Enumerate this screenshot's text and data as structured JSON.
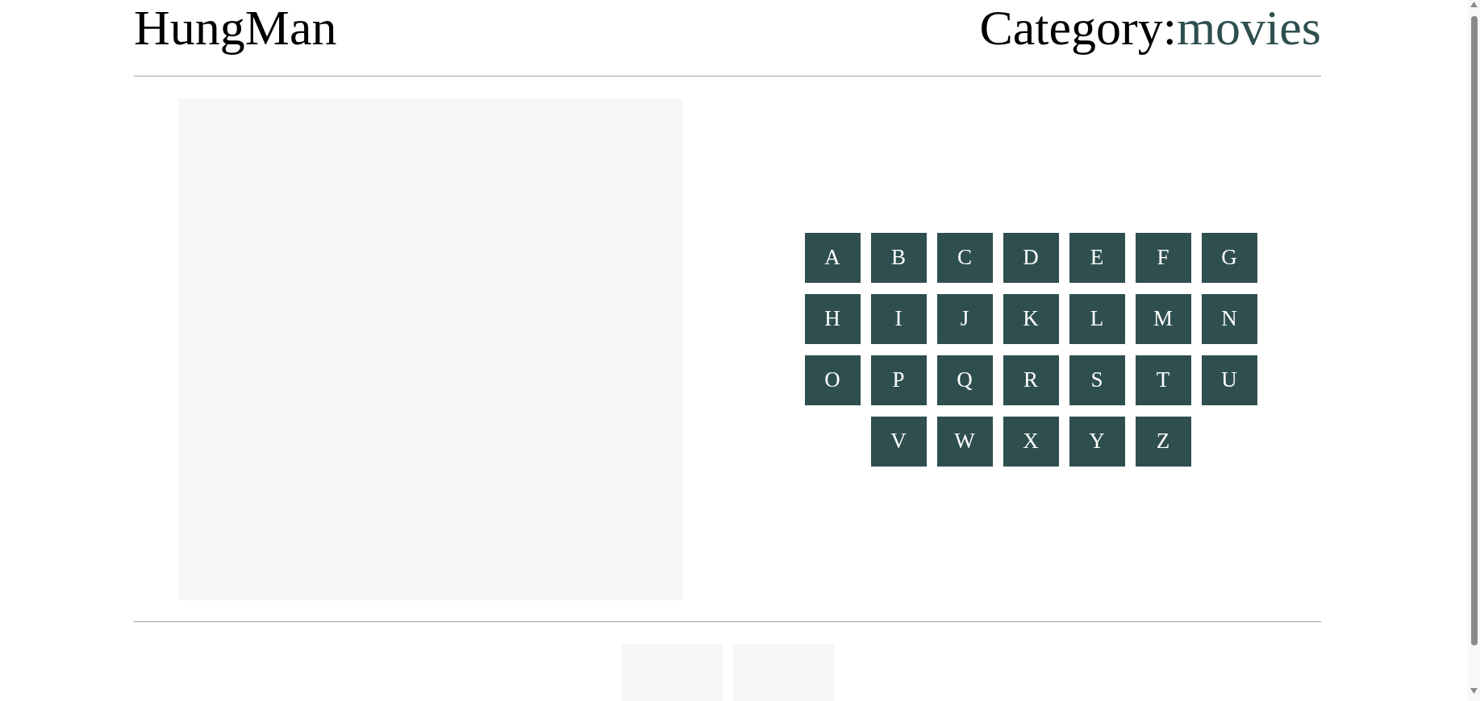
{
  "header": {
    "title": "HungMan",
    "category": {
      "label": "Category:",
      "value": "movies"
    }
  },
  "keyboard": {
    "keys": [
      "A",
      "B",
      "C",
      "D",
      "E",
      "F",
      "G",
      "H",
      "I",
      "J",
      "K",
      "L",
      "M",
      "N",
      "O",
      "P",
      "Q",
      "R",
      "S",
      "T",
      "U",
      "V",
      "W",
      "X",
      "Y",
      "Z"
    ]
  },
  "word": {
    "slots": [
      {
        "kind": "blank"
      },
      {
        "kind": "blank"
      }
    ]
  }
}
